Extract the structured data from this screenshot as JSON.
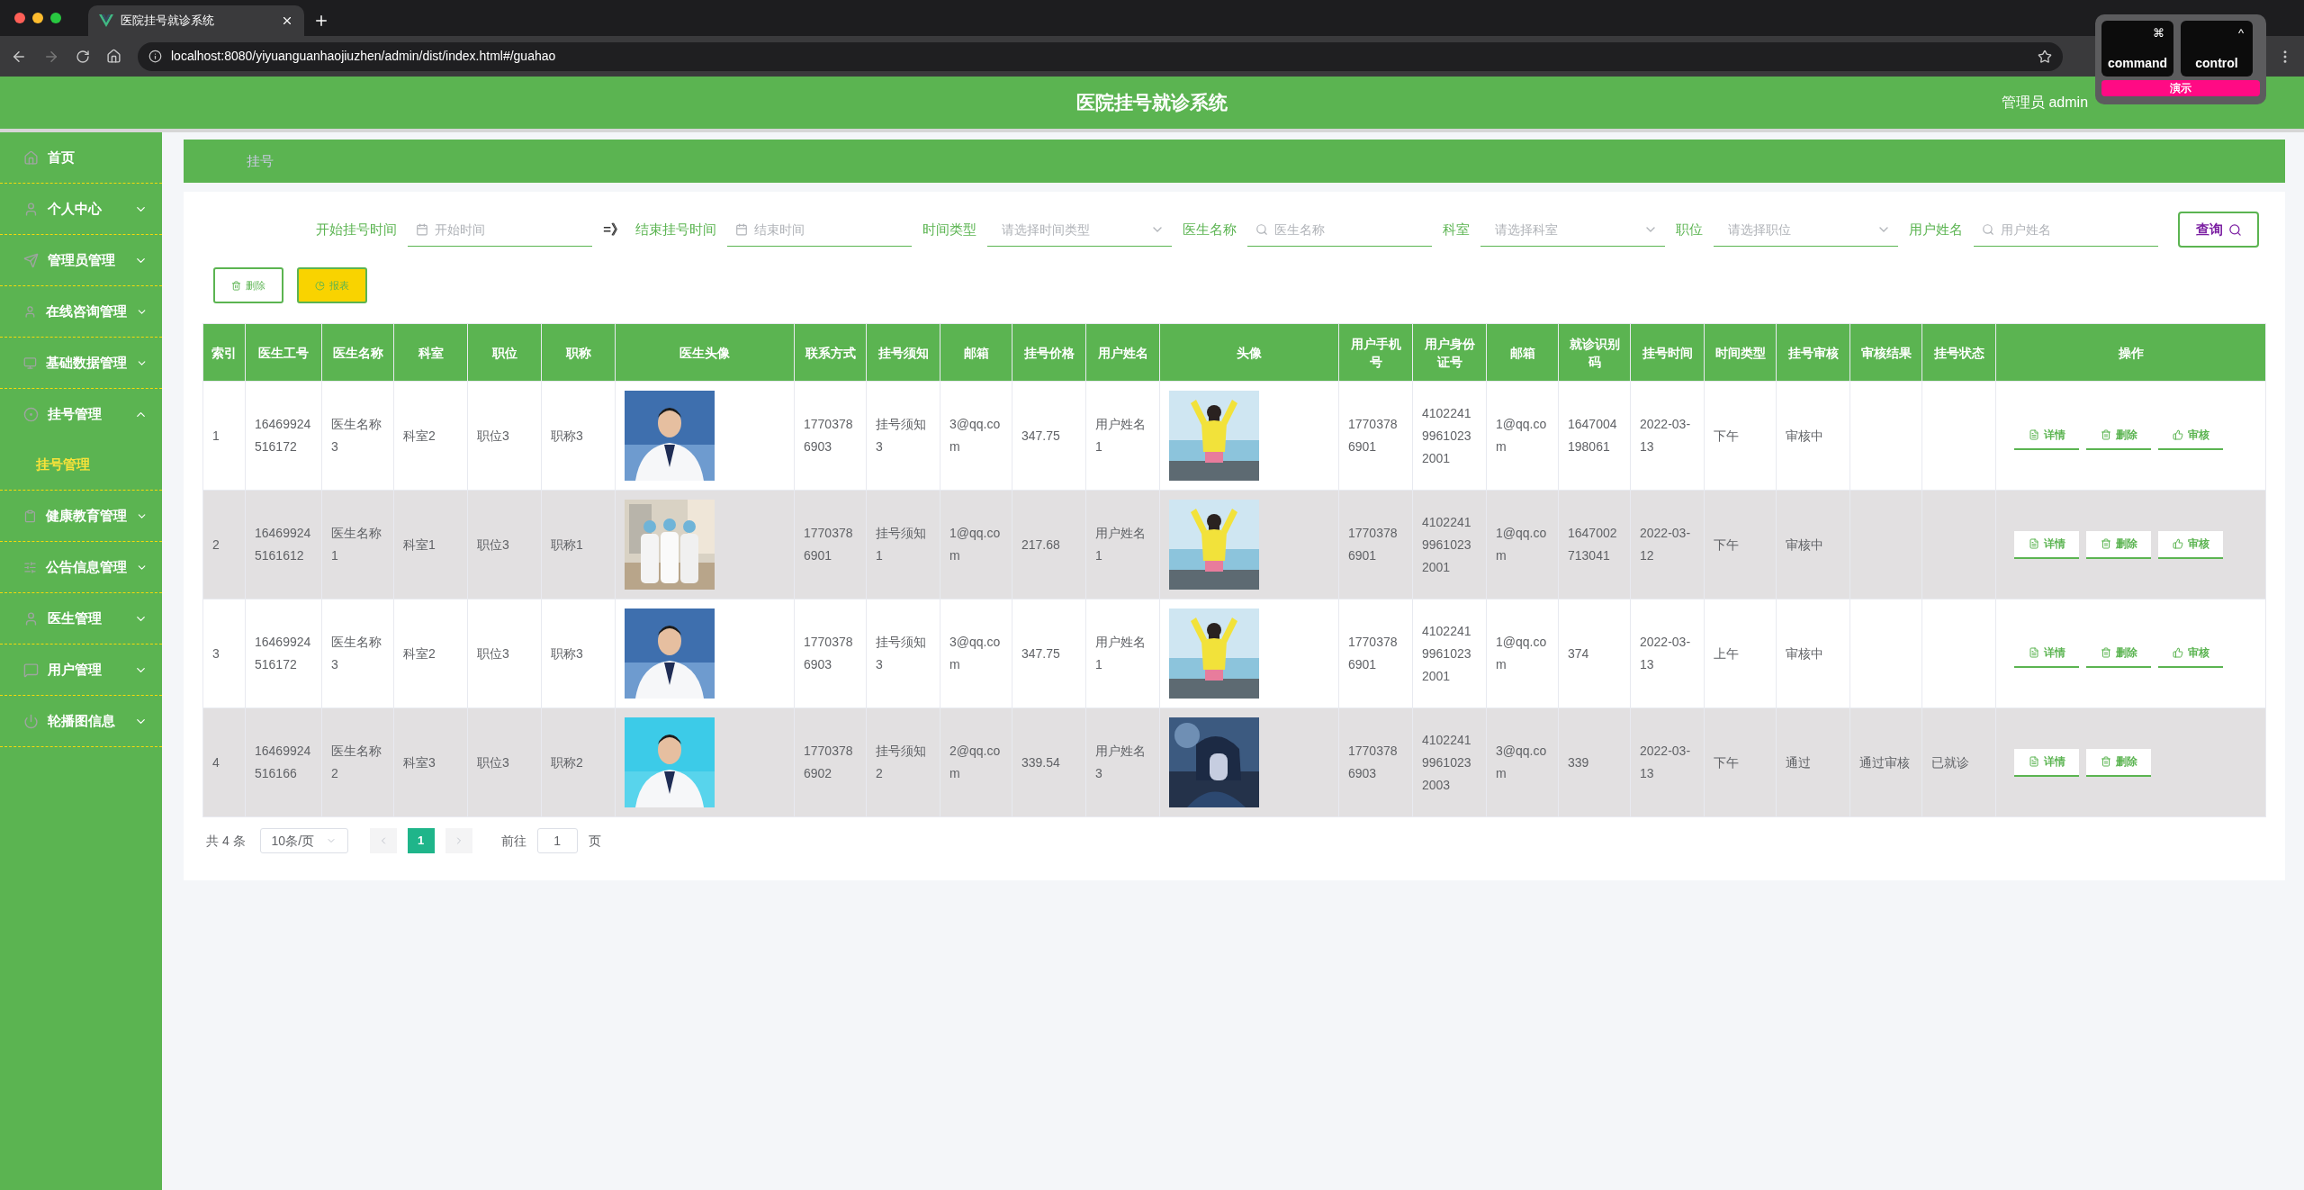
{
  "browser": {
    "tab_title": "医院挂号就诊系统",
    "url": "localhost:8080/yiyuanguanhaojiuzhen/admin/dist/index.html#/guahao"
  },
  "key_overlay": {
    "keys": [
      {
        "symbol": "⌘",
        "label": "command"
      },
      {
        "symbol": "^",
        "label": "control"
      }
    ],
    "badge": "演示"
  },
  "header": {
    "title": "医院挂号就诊系统",
    "user": "管理员 admin"
  },
  "sidebar": {
    "items": [
      {
        "label": "首页",
        "kind": "link"
      },
      {
        "label": "个人中心",
        "kind": "menu",
        "expanded": false
      },
      {
        "label": "管理员管理",
        "kind": "menu",
        "expanded": false
      },
      {
        "label": "在线咨询管理",
        "kind": "menu",
        "expanded": false
      },
      {
        "label": "基础数据管理",
        "kind": "menu",
        "expanded": false
      },
      {
        "label": "挂号管理",
        "kind": "menu",
        "expanded": true,
        "children": [
          {
            "label": "挂号管理",
            "selected": true
          }
        ]
      },
      {
        "label": "健康教育管理",
        "kind": "menu",
        "expanded": false
      },
      {
        "label": "公告信息管理",
        "kind": "menu",
        "expanded": false
      },
      {
        "label": "医生管理",
        "kind": "menu",
        "expanded": false
      },
      {
        "label": "用户管理",
        "kind": "menu",
        "expanded": false
      },
      {
        "label": "轮播图信息",
        "kind": "menu",
        "expanded": false
      }
    ]
  },
  "breadcrumb": "挂号",
  "filters": [
    {
      "kind": "date",
      "label": "开始挂号时间",
      "placeholder": "开始时间"
    },
    {
      "kind": "arrow",
      "label": "=》"
    },
    {
      "kind": "date",
      "label": "结束挂号时间",
      "placeholder": "结束时间"
    },
    {
      "kind": "select",
      "label": "时间类型",
      "placeholder": "请选择时间类型"
    },
    {
      "kind": "search",
      "label": "医生名称",
      "placeholder": "医生名称"
    },
    {
      "kind": "select",
      "label": "科室",
      "placeholder": "请选择科室"
    },
    {
      "kind": "select",
      "label": "职位",
      "placeholder": "请选择职位"
    },
    {
      "kind": "search",
      "label": "用户姓名",
      "placeholder": "用户姓名"
    }
  ],
  "query_button": "查询",
  "actions": [
    {
      "kind": "delete",
      "label": "删除"
    },
    {
      "kind": "report",
      "label": "报表"
    }
  ],
  "table": {
    "columns": [
      {
        "label": "索引",
        "kind": "text"
      },
      {
        "label": "医生工号",
        "kind": "text"
      },
      {
        "label": "医生名称",
        "kind": "text"
      },
      {
        "label": "科室",
        "kind": "text"
      },
      {
        "label": "职位",
        "kind": "text"
      },
      {
        "label": "职称",
        "kind": "text"
      },
      {
        "label": "医生头像",
        "kind": "picture"
      },
      {
        "label": "联系方式",
        "kind": "text"
      },
      {
        "label": "挂号须知",
        "kind": "text"
      },
      {
        "label": "邮箱",
        "kind": "text"
      },
      {
        "label": "挂号价格",
        "kind": "text"
      },
      {
        "label": "用户姓名",
        "kind": "text"
      },
      {
        "label": "头像",
        "kind": "picture"
      },
      {
        "label": "用户手机号",
        "kind": "text"
      },
      {
        "label": "用户身份证号",
        "kind": "text"
      },
      {
        "label": "邮箱",
        "kind": "text"
      },
      {
        "label": "就诊识别码",
        "kind": "text"
      },
      {
        "label": "挂号时间",
        "kind": "text"
      },
      {
        "label": "时间类型",
        "kind": "text"
      },
      {
        "label": "挂号审核",
        "kind": "text"
      },
      {
        "label": "审核结果",
        "kind": "text"
      },
      {
        "label": "挂号状态",
        "kind": "text"
      },
      {
        "label": "操作",
        "kind": "actions"
      }
    ],
    "rows": [
      {
        "cells": [
          "1",
          "16469924516172",
          "医生名称3",
          "科室2",
          "职位3",
          "职称3",
          {
            "kind": "picture"
          },
          "17703786903",
          "挂号须知3",
          "3@qq.com",
          "347.75",
          "用户姓名1",
          {
            "kind": "picture"
          },
          "17703786901",
          "410224199610232001",
          "1@qq.com",
          "1647004198061",
          "2022-03-13",
          "下午",
          "审核中",
          null,
          null
        ],
        "actions": [
          {
            "kind": "detail",
            "label": "详情"
          },
          {
            "kind": "delete",
            "label": "删除"
          },
          {
            "kind": "review",
            "label": "审核"
          }
        ]
      },
      {
        "cells": [
          "2",
          "164699245161612",
          "医生名称1",
          "科室1",
          "职位3",
          "职称1",
          {
            "kind": "picture"
          },
          "17703786901",
          "挂号须知1",
          "1@qq.com",
          "217.68",
          "用户姓名1",
          {
            "kind": "picture"
          },
          "17703786901",
          "410224199610232001",
          "1@qq.com",
          "1647002713041",
          "2022-03-12",
          "下午",
          "审核中",
          null,
          null
        ],
        "actions": [
          {
            "kind": "detail",
            "label": "详情"
          },
          {
            "kind": "delete",
            "label": "删除"
          },
          {
            "kind": "review",
            "label": "审核"
          }
        ]
      },
      {
        "cells": [
          "3",
          "16469924516172",
          "医生名称3",
          "科室2",
          "职位3",
          "职称3",
          {
            "kind": "picture"
          },
          "17703786903",
          "挂号须知3",
          "3@qq.com",
          "347.75",
          "用户姓名1",
          {
            "kind": "picture"
          },
          "17703786901",
          "410224199610232001",
          "1@qq.com",
          "374",
          "2022-03-13",
          "上午",
          "审核中",
          null,
          null
        ],
        "actions": [
          {
            "kind": "detail",
            "label": "详情"
          },
          {
            "kind": "delete",
            "label": "删除"
          },
          {
            "kind": "review",
            "label": "审核"
          }
        ]
      },
      {
        "cells": [
          "4",
          "16469924516166",
          "医生名称2",
          "科室3",
          "职位3",
          "职称2",
          {
            "kind": "picture"
          },
          "17703786902",
          "挂号须知2",
          "2@qq.com",
          "339.54",
          "用户姓名3",
          {
            "kind": "picture"
          },
          "17703786903",
          "410224199610232003",
          "3@qq.com",
          "339",
          "2022-03-13",
          "下午",
          "通过",
          "通过审核",
          "已就诊"
        ],
        "actions": [
          {
            "kind": "detail",
            "label": "详情"
          },
          {
            "kind": "delete",
            "label": "删除"
          }
        ]
      }
    ]
  },
  "pagination": {
    "total": "共 4 条",
    "page_size": "10条/页",
    "pages": [
      {
        "label": "1",
        "selected": true
      }
    ],
    "goto_label": "前往",
    "goto_value": "1",
    "page_suffix": "页"
  }
}
